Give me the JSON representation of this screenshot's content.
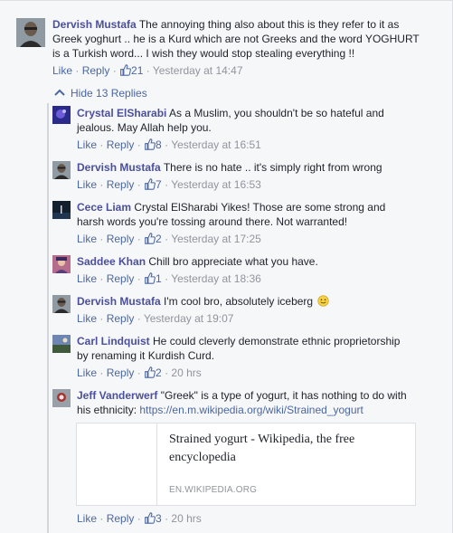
{
  "top_comment": {
    "author": "Dervish Mustafa",
    "lines": [
      "The annoying thing also about this is they refer to it as",
      "Greek yoghurt .. he is a Kurd which are not Greeks and the word YOGHURT",
      "is a Turkish word... I wish they would stop stealing everything !!"
    ],
    "like_label": "Like",
    "reply_label": "Reply",
    "likes": "21",
    "time": "Yesterday at 14:47"
  },
  "hide_replies_label": "Hide 13 Replies",
  "replies": [
    {
      "author": "Crystal ElSharabi",
      "lines": [
        "As a Muslim, you shouldn't be so hateful and",
        "jealous. May Allah help you."
      ],
      "likes": "8",
      "time": "Yesterday at 16:51"
    },
    {
      "author": "Dervish Mustafa",
      "lines": [
        "There is no hate .. it's simply right from wrong"
      ],
      "likes": "7",
      "time": "Yesterday at 16:53"
    },
    {
      "author": "Cece Liam",
      "lines": [
        "Crystal ElSharabi Yikes! Those are some strong and",
        "harsh words you're tossing around there. Not warranted!"
      ],
      "likes": "2",
      "time": "Yesterday at 17:25"
    },
    {
      "author": "Saddee Khan",
      "lines": [
        "Chill bro appreciate what you have."
      ],
      "likes": "1",
      "time": "Yesterday at 18:36"
    },
    {
      "author": "Dervish Mustafa",
      "lines": [
        "I'm cool bro, absolutely iceberg"
      ],
      "likes": "",
      "time": "Yesterday at 19:07"
    },
    {
      "author": "Carl Lindquist",
      "lines": [
        "He could cleverly demonstrate ethnic proprietorship",
        "by renaming it Kurdish Curd."
      ],
      "likes": "2",
      "time": "20 hrs"
    },
    {
      "author": "Jeff Vanderwerf",
      "lines": [
        "\"Greek\" is a type of yogurt, it has nothing to do with",
        "his ethnicity: "
      ],
      "link": "https://en.m.wikipedia.org/wiki/Strained_yogurt",
      "likes": "3",
      "time": "20 hrs"
    }
  ],
  "preview": {
    "title": "Strained yogurt - Wikipedia, the free encyclopedia",
    "domain": "EN.WIKIPEDIA.ORG"
  },
  "labels": {
    "like": "Like",
    "reply": "Reply",
    "sep": " · "
  },
  "icons": {
    "like": "thumbs-up-icon",
    "collapse": "chevron-up-icon",
    "smiley": "smiley-icon"
  },
  "colors": {
    "name": "#4b4f9c",
    "link": "#4b67a1",
    "meta": "#90949c"
  }
}
